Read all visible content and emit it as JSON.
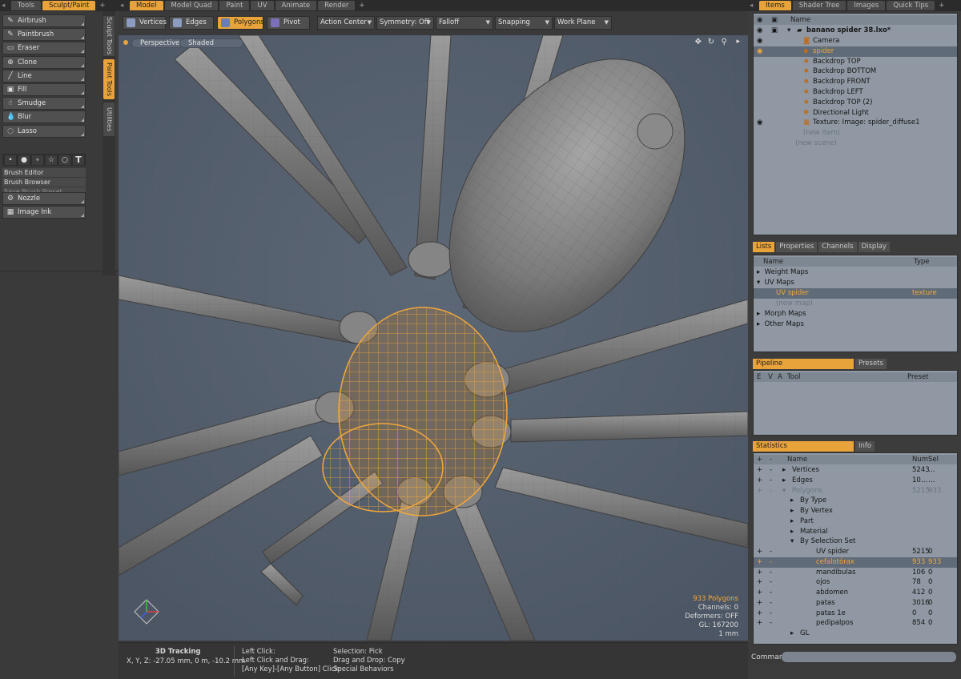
{
  "left_tabs": [
    "Tools",
    "Sculpt/Paint"
  ],
  "left_tab_active": "Sculpt/Paint",
  "layout_tabs": [
    "Model",
    "Model Quad",
    "Paint",
    "UV",
    "Animate",
    "Render"
  ],
  "right_tabs": [
    "Items",
    "Shader Tree",
    "Images",
    "Quick Tips"
  ],
  "tools": [
    {
      "label": "Airbrush",
      "icon": "airbrush-icon",
      "glyph": "✎"
    },
    {
      "label": "Paintbrush",
      "icon": "paintbrush-icon",
      "glyph": "✎"
    },
    {
      "label": "Eraser",
      "icon": "eraser-icon",
      "glyph": "▭"
    },
    {
      "label": "Clone",
      "icon": "clone-icon",
      "glyph": "⊕"
    },
    {
      "label": "Line",
      "icon": "line-icon",
      "glyph": "╱"
    },
    {
      "label": "Fill",
      "icon": "fill-icon",
      "glyph": "▣"
    },
    {
      "label": "Smudge",
      "icon": "smudge-icon",
      "glyph": "☝"
    },
    {
      "label": "Blur",
      "icon": "blur-icon",
      "glyph": "💧"
    },
    {
      "label": "Lasso",
      "icon": "lasso-icon",
      "glyph": "◌"
    }
  ],
  "brush_shapes": [
    "•",
    "●",
    "∘",
    "☆",
    "○",
    "T"
  ],
  "brush": {
    "editor": "Brush Editor",
    "browser": "Brush Browser",
    "save_preset": "Save Brush Preset"
  },
  "nozzle": {
    "nozzle": "Nozzle",
    "image_ink": "Image Ink"
  },
  "vertical_tabs": [
    "Sculpt Tools",
    "Paint Tools",
    "Utilities"
  ],
  "toolbar": {
    "vertices": "Vertices",
    "edges": "Edges",
    "polygons": "Polygons",
    "pivot": "Pivot",
    "action_center": "Action Center",
    "symmetry": "Symmetry: Off",
    "falloff": "Falloff",
    "snapping": "Snapping",
    "work_plane": "Work Plane"
  },
  "viewport": {
    "view": "Perspective",
    "shading": "Shaded",
    "poly_count": "933 Polygons",
    "channels": "Channels: 0",
    "deformers": "Deformers: OFF",
    "gl": "GL: 167200",
    "unit": "1 mm"
  },
  "status": {
    "tracking": "3D Tracking",
    "coords": "X, Y, Z:  -27.05 mm, 0 m, -10.2 mm",
    "l1": "Left Click:",
    "l2": "Left Click and Drag:",
    "l3": "[Any Key]-[Any Button] Click:",
    "r1": "Selection: Pick",
    "r2": "Drag and Drop: Copy",
    "r3": "Special Behaviors"
  },
  "items": {
    "header": "Name",
    "scene": "banano spider 38.lxo*",
    "rows": [
      "Camera",
      "spider",
      "Backdrop TOP",
      "Backdrop BOTTOM",
      "Backdrop FRONT",
      "Backdrop LEFT",
      "Backdrop TOP (2)",
      "Directional Light",
      "Texture: Image: spider_diffuse1"
    ],
    "new_item": "(new item)",
    "new_scene": "(new scene)"
  },
  "lists_tabs": [
    "Lists",
    "Properties",
    "Channels",
    "Display"
  ],
  "lists": {
    "name_header": "Name",
    "type_header": "Type",
    "weight_maps": "Weight Maps",
    "uv_maps": "UV Maps",
    "uv_spider": "UV spider",
    "uv_type": "texture",
    "new_map": "(new map)",
    "morph_maps": "Morph Maps",
    "other_maps": "Other Maps"
  },
  "pipeline": {
    "tab1": "Pipeline",
    "tab2": "Presets",
    "cols": [
      "E",
      "V",
      "A",
      "Tool",
      "Preset"
    ]
  },
  "statistics": {
    "tab1": "Statistics",
    "tab2": "Info",
    "cols": [
      "Name",
      "Num",
      "Sel"
    ],
    "rows": [
      {
        "name": "Vertices",
        "num": "5243",
        "sel": "…"
      },
      {
        "name": "Edges",
        "num": "10…",
        "sel": "…"
      },
      {
        "name": "Polygons",
        "num": "5215",
        "sel": "933"
      },
      {
        "name": "By Type",
        "num": "",
        "sel": ""
      },
      {
        "name": "By Vertex",
        "num": "",
        "sel": ""
      },
      {
        "name": "Part",
        "num": "",
        "sel": ""
      },
      {
        "name": "Material",
        "num": "",
        "sel": ""
      },
      {
        "name": "By Selection Set",
        "num": "",
        "sel": ""
      },
      {
        "name": "UV spider",
        "num": "5215",
        "sel": "0"
      },
      {
        "name": "cefalotórax",
        "num": "933",
        "sel": "933"
      },
      {
        "name": "mandíbulas",
        "num": "106",
        "sel": "0"
      },
      {
        "name": "ojos",
        "num": "78",
        "sel": "0"
      },
      {
        "name": "abdomen",
        "num": "412",
        "sel": "0"
      },
      {
        "name": "patas",
        "num": "3016",
        "sel": "0"
      },
      {
        "name": "patas 1e",
        "num": "0",
        "sel": "0"
      },
      {
        "name": "pedipalpos",
        "num": "854",
        "sel": "0"
      },
      {
        "name": "GL",
        "num": "",
        "sel": ""
      }
    ]
  },
  "command": {
    "label": "Command"
  },
  "colors": {
    "accent": "#e8a33a",
    "viewport_bg": "#566170",
    "panel_bg": "#8f98a3"
  }
}
